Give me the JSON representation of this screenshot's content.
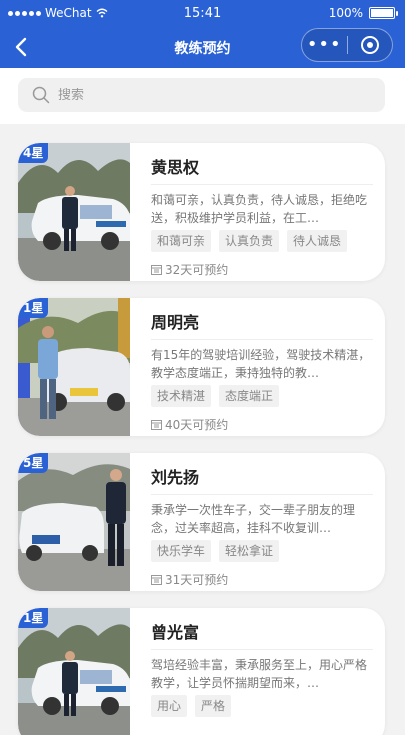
{
  "statusbar": {
    "carrier": "WeChat",
    "time": "15:41",
    "battery": "100%"
  },
  "nav": {
    "title": "教练预约"
  },
  "search": {
    "placeholder": "搜索"
  },
  "coaches": [
    {
      "stars": "4星",
      "name": "黄思权",
      "desc": "和蔼可亲，认真负责，待人诚恳，拒绝吃送，积极维护学员利益，在工…",
      "tags": [
        "和蔼可亲",
        "认真负责",
        "待人诚恳"
      ],
      "availability": "32天可预约"
    },
    {
      "stars": "1星",
      "name": "周明亮",
      "desc": "有15年的驾驶培训经验，驾驶技术精湛，教学态度端正，秉持独特的教…",
      "tags": [
        "技术精湛",
        "态度端正"
      ],
      "availability": "40天可预约"
    },
    {
      "stars": "5星",
      "name": "刘先扬",
      "desc": "秉承学一次性车子，交一辈子朋友的理念，过关率超高，挂科不收复训…",
      "tags": [
        "快乐学车",
        "轻松拿证"
      ],
      "availability": "31天可预约"
    },
    {
      "stars": "1星",
      "name": "曾光富",
      "desc": "驾培经验丰富，秉承服务至上，用心严格教学，让学员怀揣期望而来，…",
      "tags": [
        "用心",
        "严格"
      ],
      "availability": ""
    }
  ],
  "colors": {
    "primary": "#2a62d6"
  },
  "icons": {
    "back": "chevron-left-icon",
    "more": "more-dots-icon",
    "target": "target-icon",
    "search": "search-icon",
    "calendar": "calendar-icon"
  }
}
